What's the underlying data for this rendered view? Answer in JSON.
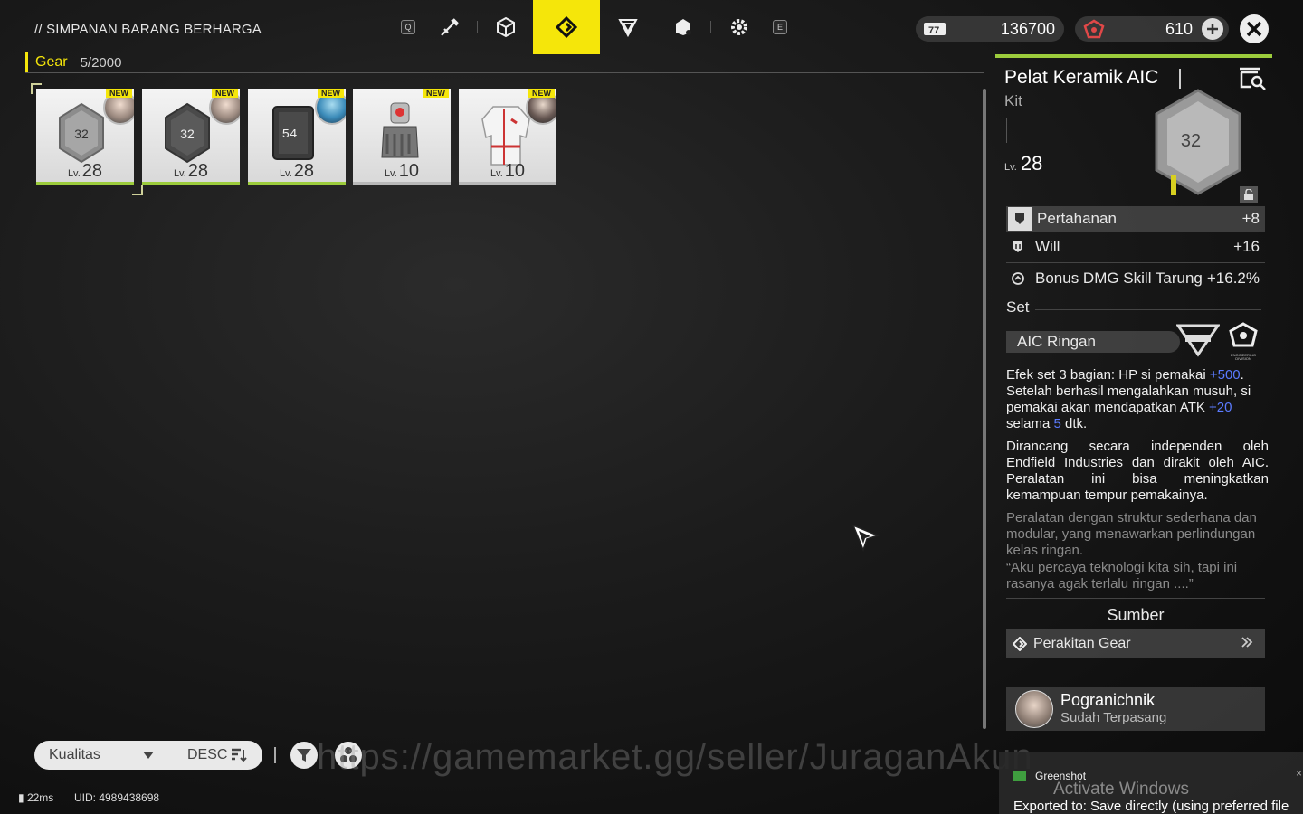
{
  "header": {
    "title": "// SIMPANAN BARANG BERHARGA",
    "tabs": [
      {
        "key": "Q",
        "type": "key"
      },
      {
        "icon": "weapon-icon"
      },
      {
        "icon": "cube-icon"
      },
      {
        "icon": "gear-diamond-icon",
        "active": true
      },
      {
        "icon": "triangle-shield-icon"
      },
      {
        "icon": "package-icon"
      },
      {
        "icon": "cog-icon"
      },
      {
        "key": "E",
        "type": "key"
      }
    ],
    "currency1": "136700",
    "currency2": "610"
  },
  "gear": {
    "label": "Gear",
    "count": "5/2000"
  },
  "items": [
    {
      "lv_prefix": "Lv.",
      "lv": "28",
      "badge": "NEW",
      "icon": "hex-plate-icon",
      "plate": "32",
      "selected": true
    },
    {
      "lv_prefix": "Lv.",
      "lv": "28",
      "badge": "NEW",
      "icon": "hex-plate-icon",
      "plate": "32"
    },
    {
      "lv_prefix": "Lv.",
      "lv": "28",
      "badge": "NEW",
      "icon": "armor-box-icon",
      "plate": "54"
    },
    {
      "lv_prefix": "Lv.",
      "lv": "10",
      "badge": "NEW",
      "icon": "glove-icon"
    },
    {
      "lv_prefix": "Lv.",
      "lv": "10",
      "badge": "NEW",
      "icon": "jacket-icon"
    }
  ],
  "detail": {
    "name": "Pelat Keramik AIC",
    "type": "Kit",
    "lv_prefix": "Lv.",
    "lv": "28",
    "plate": "32",
    "stats": [
      {
        "name": "Pertahanan",
        "value": "+8"
      },
      {
        "name": "Will",
        "value": "+16"
      },
      {
        "name": "Bonus DMG Skill Tarung",
        "value": "+16.2%"
      }
    ],
    "set_label": "Set",
    "set_name": "AIC Ringan",
    "set_logo_text": "ENGINEERING DIVISION",
    "effect": {
      "p1": "Efek set 3 bagian: HP si pemakai ",
      "v1": "+500",
      "p2": ". Setelah berhasil mengalahkan musuh, si pemakai akan mendapatkan ATK ",
      "v2": "+20",
      "p3": " selama ",
      "v3": "5",
      "p4": " dtk."
    },
    "description": "Dirancang secara independen oleh Endfield Industries dan dirakit oleh AIC. Peralatan ini bisa meningkatkan kemampuan tempur pemakainya.",
    "lore1": "Peralatan dengan struktur sederhana dan modular, yang menawarkan perlindungan kelas ringan.",
    "lore2": "“Aku percaya teknologi kita sih, tapi ini rasanya agak terlalu ringan ....”",
    "source_label": "Sumber",
    "source_item": "Perakitan Gear",
    "owner_name": "Pogranichnik",
    "owner_status": "Sudah Terpasang"
  },
  "bottom": {
    "sort": "Kualitas",
    "order": "DESC",
    "ping": "22ms",
    "uid": "UID: 4989438698",
    "watermark": "https://gamemarket.gg/seller/JuraganAkun"
  },
  "toast": {
    "app": "Greenshot",
    "activate": "Activate Windows",
    "message": "Exported to: Save directly (using preferred file"
  },
  "colors": {
    "accent": "#f5e60a",
    "rarity_green": "#9ccc3c",
    "value_blue": "#5b7bff"
  }
}
